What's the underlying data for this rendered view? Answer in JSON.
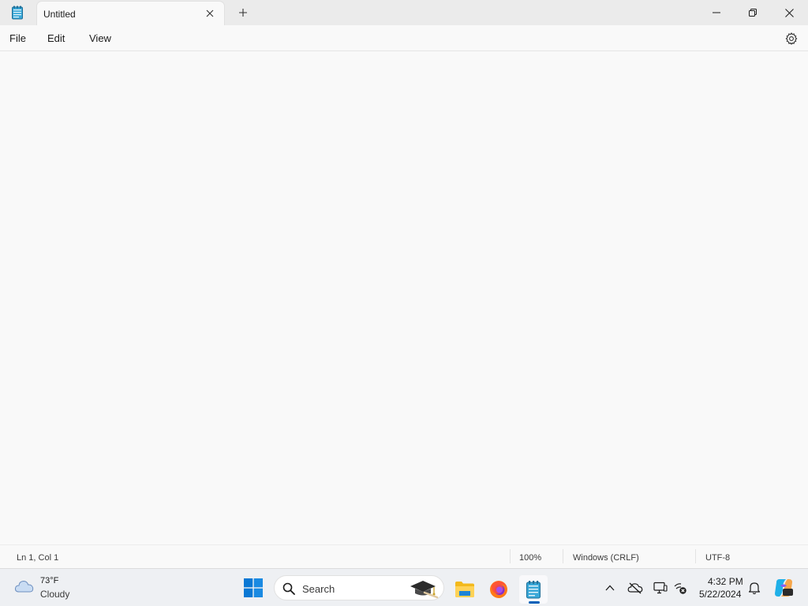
{
  "window": {
    "tab_title": "Untitled",
    "new_tab_symbol": "+"
  },
  "menu": {
    "file": "File",
    "edit": "Edit",
    "view": "View"
  },
  "editor": {
    "content": ""
  },
  "status": {
    "position": "Ln 1, Col 1",
    "zoom": "100%",
    "line_ending": "Windows (CRLF)",
    "encoding": "UTF-8"
  },
  "taskbar": {
    "weather": {
      "temperature": "73°F",
      "condition": "Cloudy",
      "icon": "cloud-icon"
    },
    "search": {
      "label": "Search"
    },
    "pinned_apps": [
      "file-explorer",
      "firefox",
      "notepad"
    ],
    "active_app": "notepad",
    "clock": {
      "time": "4:32 PM",
      "date": "5/22/2024"
    }
  },
  "colors": {
    "accent": "#005fb8",
    "titlebar": "#ebebeb",
    "background": "#f9f9f9",
    "taskbar": "#eef0f3"
  }
}
